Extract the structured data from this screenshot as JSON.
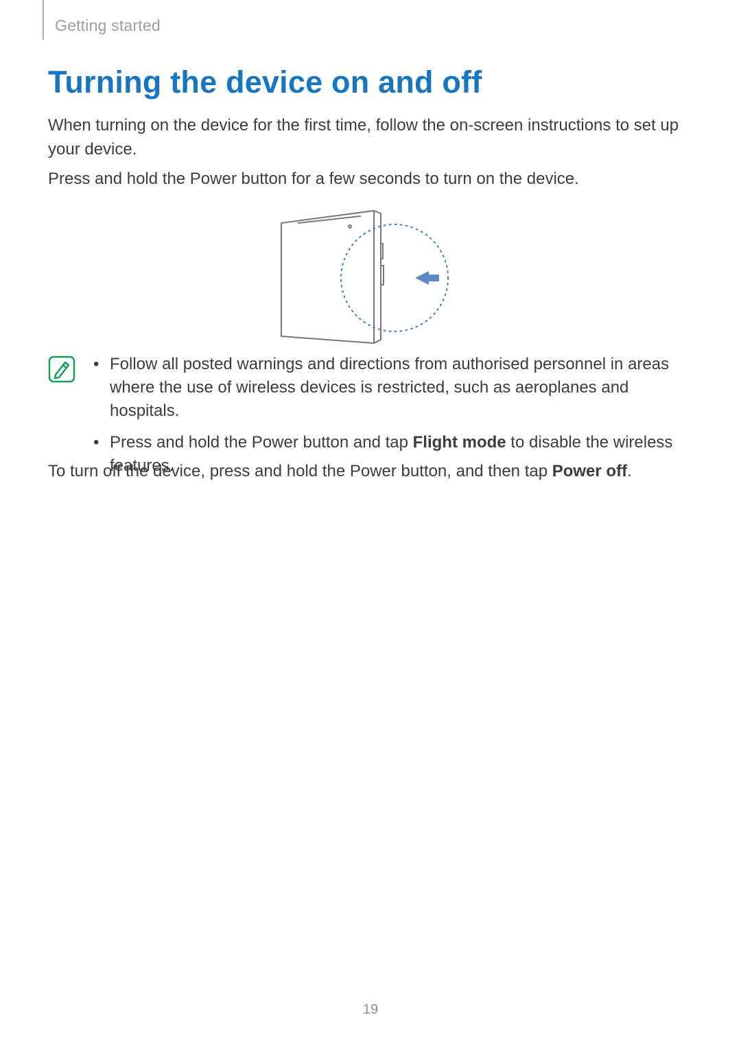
{
  "header": {
    "section_label": "Getting started"
  },
  "title": "Turning the device on and off",
  "paragraphs": {
    "p1": "When turning on the device for the first time, follow the on-screen instructions to set up your device.",
    "p2": "Press and hold the Power button for a few seconds to turn on the device.",
    "p3_prefix": "To turn off the device, press and hold the Power button, and then tap ",
    "p3_bold": "Power off",
    "p3_suffix": "."
  },
  "note": {
    "items": [
      {
        "text": "Follow all posted warnings and directions from authorised personnel in areas where the use of wireless devices is restricted, such as aeroplanes and hospitals."
      },
      {
        "prefix": "Press and hold the Power button and tap ",
        "bold": "Flight mode",
        "suffix": " to disable the wireless features."
      }
    ]
  },
  "icons": {
    "note_icon": "note-pencil-icon",
    "device_diagram": "device-power-button-diagram",
    "arrow": "press-arrow-icon"
  },
  "colors": {
    "accent": "#1876c0",
    "muted": "#9e9e9e",
    "note_border": "#14a05a",
    "arrow": "#5a8bc4",
    "dotted": "#3b7cc0"
  },
  "page_number": "19"
}
